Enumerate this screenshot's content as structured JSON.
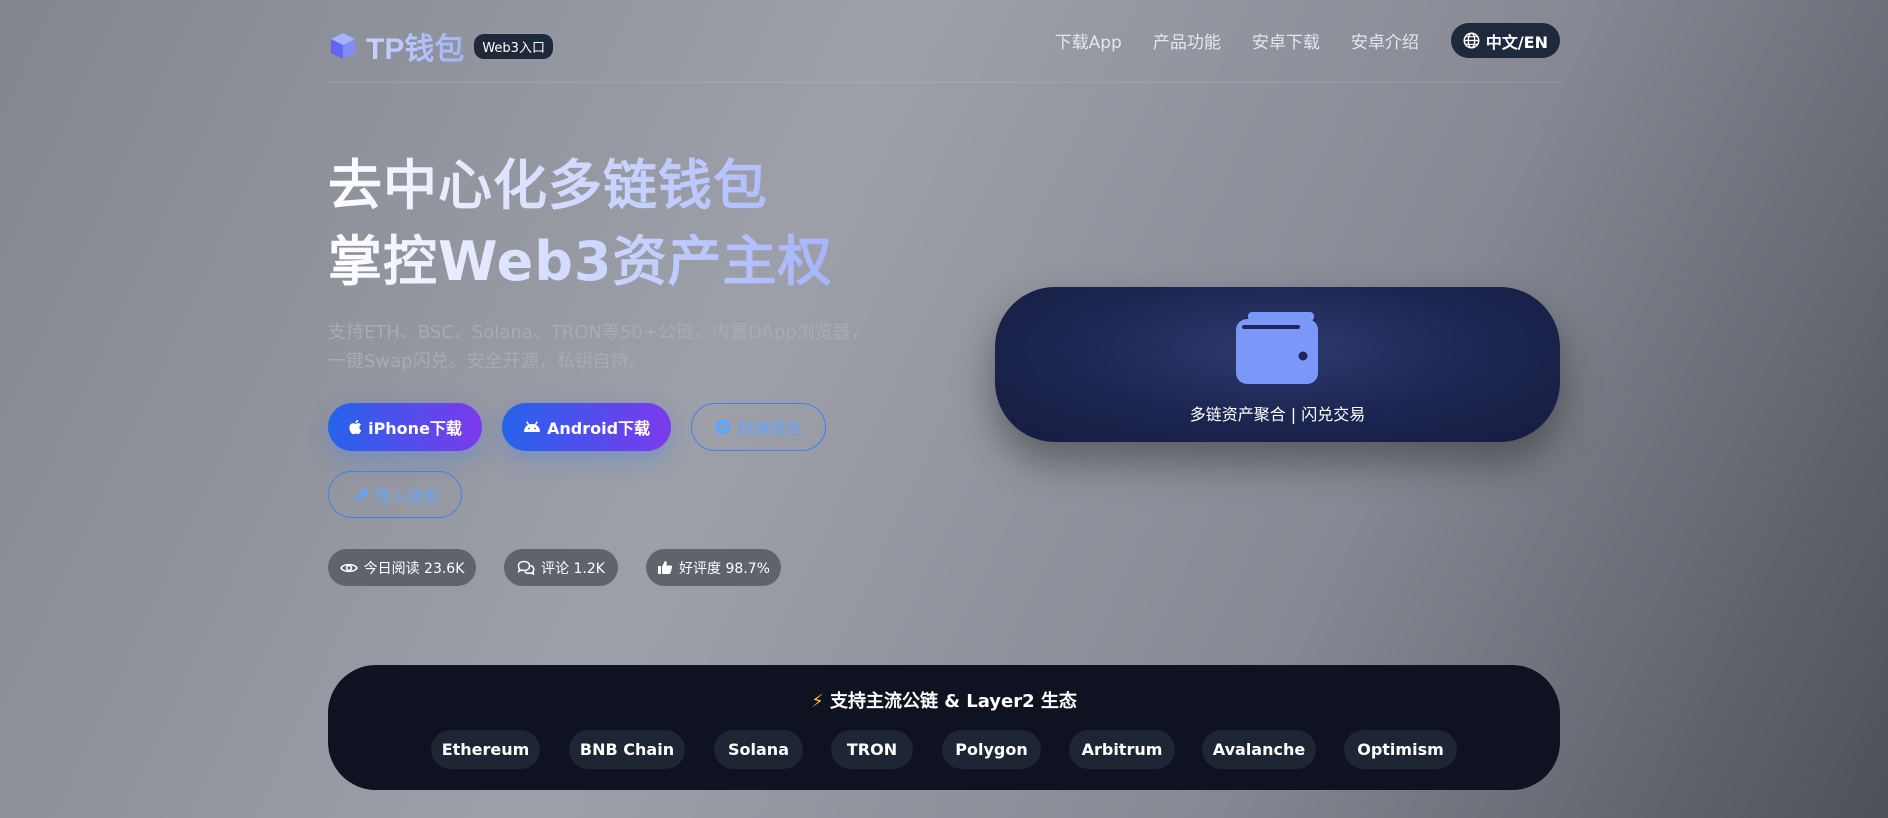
{
  "header": {
    "logo_text": "TP钱包",
    "badge": "Web3入口",
    "nav": [
      "下载App",
      "产品功能",
      "安卓下载",
      "安卓介绍"
    ],
    "lang": "中文/EN"
  },
  "hero": {
    "title_line1": "去中心化多链钱包",
    "title_line2": "掌控Web3资产主权",
    "desc_line1": "支持ETH、BSC、Solana、TRON等50+公链，内置DApp浏览器，",
    "desc_line2": "一键Swap闪兑。安全开源，私钥自持。"
  },
  "buttons": {
    "iphone": "iPhone下载",
    "android": "Android下载",
    "create": "创建钱包",
    "import": "导入钱包"
  },
  "stats": {
    "reads": "今日阅读 23.6K",
    "comments": "评论 1.2K",
    "rating": "好评度 98.7%"
  },
  "card": {
    "text": "多链资产聚合 | 闪兑交易"
  },
  "chains": {
    "title": "支持主流公链 & Layer2 生态",
    "items": [
      "Ethereum",
      "BNB Chain",
      "Solana",
      "TRON",
      "Polygon",
      "Arbitrum",
      "Avalanche",
      "Optimism"
    ]
  },
  "colors": {
    "accent_blue": "#2563eb",
    "accent_purple": "#7c3aed",
    "dark_panel": "#0f1220",
    "wallet_icon": "#7b97f8"
  }
}
